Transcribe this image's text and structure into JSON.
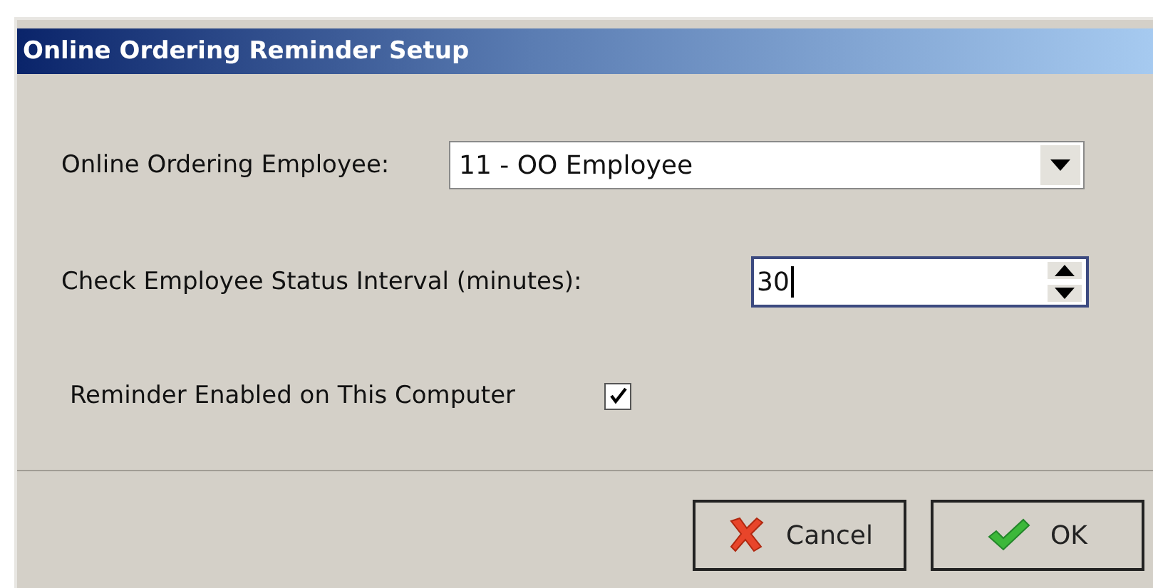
{
  "window": {
    "title": "Online Ordering Reminder Setup"
  },
  "employee": {
    "label": "Online Ordering Employee:",
    "value": "11 - OO Employee"
  },
  "interval": {
    "label": "Check Employee Status Interval (minutes):",
    "value": "30",
    "focused": true
  },
  "reminder": {
    "label": "Reminder Enabled on This Computer",
    "checked": true
  },
  "buttons": [
    {
      "label": "Cancel",
      "kind": "cancel"
    },
    {
      "label": "OK",
      "kind": "ok"
    }
  ]
}
